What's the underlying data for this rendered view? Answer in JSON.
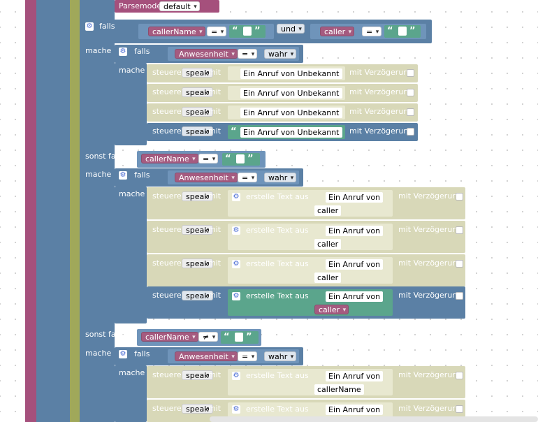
{
  "labels": {
    "parsemode": "Parsemode",
    "falls": "falls",
    "mache": "mache",
    "sonst_falls": "sonst falls",
    "und": "und",
    "steuere": "steuere",
    "mit": "mit",
    "mit_verzoegerung": "mit Verzögerung",
    "erstelle_text": "erstelle Text aus",
    "quote_open": "“",
    "quote_close": "”"
  },
  "values": {
    "parsemode": "default",
    "callerName": "callerName",
    "caller": "caller",
    "eq": "=",
    "neq": "≠",
    "anwesenheit": "Anwesenheit",
    "wahr": "wahr",
    "speak": "speak",
    "ein_anruf_unbekannt": "Ein Anruf von Unbekannt",
    "ein_anruf_von": "Ein Anruf von"
  },
  "colors": {
    "pink": "#a5507c",
    "olive": "#a0a85a",
    "control_blue": "#5b80a5",
    "logic_blue": "#5b80a5",
    "variable_pink": "#a55b80",
    "text_green": "#5ba58c",
    "disabled": "#d8d8b8"
  }
}
